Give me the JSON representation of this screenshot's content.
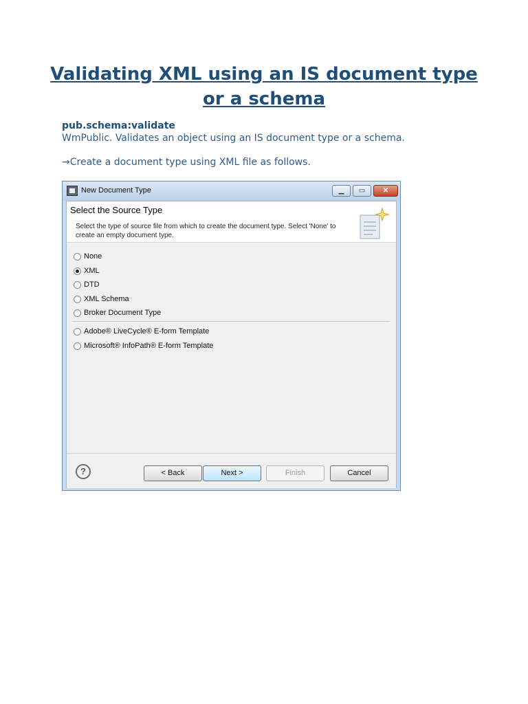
{
  "document": {
    "title": "Validating XML using an IS document type or a schema",
    "subheading": "pub.schema:validate",
    "description": "WmPublic. Validates an object using an IS document type or a schema.",
    "instruction": "→Create a document type using XML file as follows."
  },
  "dialog": {
    "window_title": "New Document Type",
    "header_title": "Select the Source Type",
    "header_description": "Select the type of source file from which to create the document type. Select 'None' to create an empty document type.",
    "options": [
      {
        "label": "None",
        "selected": false
      },
      {
        "label": "XML",
        "selected": true
      },
      {
        "label": "DTD",
        "selected": false
      },
      {
        "label": "XML Schema",
        "selected": false
      },
      {
        "label": "Broker Document Type",
        "selected": false
      },
      {
        "label": "Adobe® LiveCycle® E-form Template",
        "selected": false
      },
      {
        "label": "Microsoft® InfoPath® E-form Template",
        "selected": false
      }
    ],
    "buttons": {
      "back": "< Back",
      "next": "Next >",
      "finish": "Finish",
      "cancel": "Cancel"
    },
    "icons": {
      "app": "app-window-icon",
      "wizard": "document-sparkle-icon",
      "help": "help-icon"
    },
    "colors": {
      "title_blue": "#1f4e79",
      "text_blue": "#2e5b8a",
      "dialog_frame": "#c9d9ec",
      "close_red": "#c4442a"
    }
  }
}
